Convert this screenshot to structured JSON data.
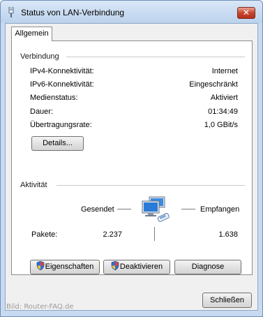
{
  "window": {
    "title": "Status von LAN-Verbindung",
    "close_glyph": "✕"
  },
  "tabs": [
    {
      "label": "Allgemein",
      "active": true
    }
  ],
  "connection": {
    "group_title": "Verbindung",
    "rows": [
      {
        "label": "IPv4-Konnektivität:",
        "value": "Internet"
      },
      {
        "label": "IPv6-Konnektivität:",
        "value": "Eingeschränkt"
      },
      {
        "label": "Medienstatus:",
        "value": "Aktiviert"
      },
      {
        "label": "Dauer:",
        "value": "01:34:49"
      },
      {
        "label": "Übertragungsrate:",
        "value": "1,0 GBit/s"
      }
    ],
    "details_button": "Details..."
  },
  "activity": {
    "group_title": "Aktivität",
    "sent_label": "Gesendet",
    "received_label": "Empfangen",
    "packets_label": "Pakete:",
    "packets_sent": "2.237",
    "packets_received": "1.638",
    "icon": "network-computer-icon"
  },
  "actions": {
    "properties": "Eigenschaften",
    "deactivate": "Deaktivieren",
    "diagnose": "Diagnose"
  },
  "footer": {
    "close_button": "Schließen",
    "watermark": "Bild: Router-FAQ.de"
  },
  "colors": {
    "close_red": "#c7462f",
    "frame_blue": "#c8daf0",
    "shield_blue": "#2f6fd1",
    "shield_yellow": "#f2c431"
  }
}
